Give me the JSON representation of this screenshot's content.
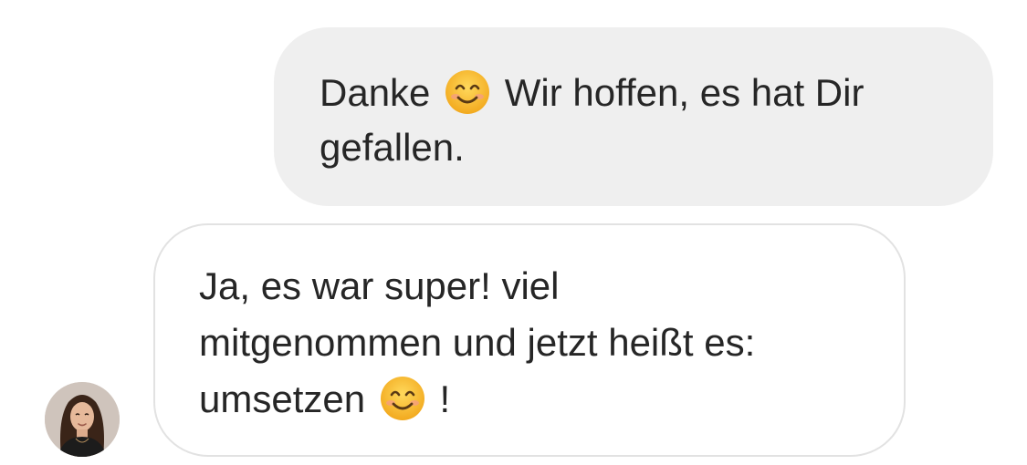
{
  "thread": {
    "outgoing": {
      "line1_before": "Danke",
      "line1_after": "Wir hoffen, es hat Dir",
      "line2": "gefallen.",
      "emoji": "smiling-face-icon"
    },
    "incoming": {
      "line1": "Ja, es war super! viel",
      "line2": "mitgenommen und jetzt heißt es:",
      "line3_before": "umsetzen",
      "line3_after": "!",
      "emoji": "smiling-face-icon"
    },
    "avatar": "sender-avatar"
  },
  "colors": {
    "outgoing_bubble": "#efefef",
    "incoming_border": "#e2e2e2",
    "text": "#262626",
    "emoji_face": "#f7c33e"
  }
}
